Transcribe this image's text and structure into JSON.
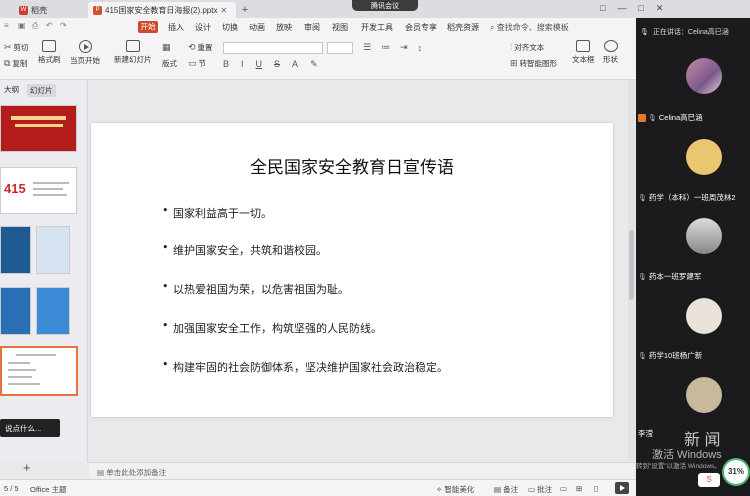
{
  "titlebar": {
    "home_tab": "稻壳",
    "doc_tab": "415国家安全教育日海报(2).pptx",
    "add_tab": "+",
    "meeting_pill": "腾讯会议",
    "window_controls": [
      "□",
      "—",
      "□",
      "✕"
    ]
  },
  "menubar": {
    "start": "开始",
    "items": [
      "插入",
      "设计",
      "切换",
      "动画",
      "放映",
      "审阅",
      "视图",
      "开发工具",
      "会员专享",
      "稻壳资源"
    ],
    "search": "查找命令、搜索模板"
  },
  "ribbon": {
    "cut": "剪切",
    "copy": "复制",
    "format_painter": "格式刷",
    "from_current": "当页开始",
    "new_slide": "新建幻灯片",
    "layout": "版式",
    "section": "节",
    "reset": "重置",
    "bold": "B",
    "italic": "I",
    "underline": "U",
    "strike": "S",
    "align_text": "对齐文本",
    "convert_smartart": "转智能图形",
    "textbox": "文本框",
    "shape": "形状"
  },
  "leftpane": {
    "tab_outline": "大纲",
    "tab_slides": "幻灯片",
    "thumb2_label": "415",
    "tooltip": "说点什么...",
    "add_slide": "+"
  },
  "slide": {
    "title": "全民国家安全教育日宣传语",
    "bullets": [
      "国家利益高于一切。",
      "维护国家安全，共筑和谐校园。",
      "以热爱祖国为荣，以危害祖国为耻。",
      "加强国家安全工作，构筑坚强的人民防线。",
      "构建牢固的社会防御体系，坚决维护国家社会政治稳定。"
    ]
  },
  "notes": "单击此处添加备注",
  "statusbar": {
    "slide_count": "5 / 5",
    "theme": "Office 主题",
    "smart_beautify": "智能美化",
    "notes_btn": "备注",
    "comment_btn": "批注",
    "zoom": "70%"
  },
  "meeting": {
    "speaking": "正在讲话：Celina高巳涵",
    "participants": [
      {
        "name": "Celina高巳涵"
      },
      {
        "name": "药学（本科）一班周茂林2"
      },
      {
        "name": "药本一班罗建军"
      },
      {
        "name": "药学10班杨广新"
      },
      {
        "name": "李滢"
      }
    ],
    "watermark": "新 闻",
    "activate_title": "激活 Windows",
    "activate_sub": "转到\"设置\"以激活 Windows。",
    "percent": "31%",
    "ime": "S"
  },
  "colors": {
    "accent": "#d04a2e",
    "meeting_bg": "#1b1b1d",
    "selected_thumb_border": "#e6733d"
  }
}
